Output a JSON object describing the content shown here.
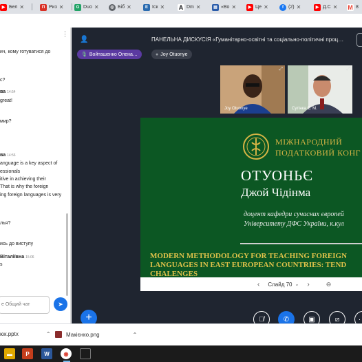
{
  "browser": {
    "tabs": [
      {
        "label": "Бел",
        "favicon": "youtube-icon",
        "color": "#ff0000"
      },
      {
        "label": "Риз",
        "favicon": "pk-icon",
        "color": "#d93025"
      },
      {
        "label": "Duo",
        "favicon": "duo-icon",
        "color": "#21a366"
      },
      {
        "label": "Біб",
        "favicon": "globe-icon",
        "color": "#5f6368"
      },
      {
        "label": "Іск",
        "favicon": "e-icon",
        "color": "#2b6cb0"
      },
      {
        "label": "Dm",
        "favicon": "a-icon",
        "color": "#202124"
      },
      {
        "label": "«Во",
        "favicon": "doc-icon",
        "color": "#2a5caa"
      },
      {
        "label": "Це",
        "favicon": "youtube-icon",
        "color": "#ff0000"
      },
      {
        "label": "(2)",
        "favicon": "facebook-icon",
        "color": "#1877f2"
      },
      {
        "label": "Д.С",
        "favicon": "youtube-icon",
        "color": "#ff0000"
      },
      {
        "label": "8",
        "favicon": "gmail-icon",
        "color": "#ea4335"
      }
    ]
  },
  "chat": {
    "lines": [
      {
        "text": "ич, кому готуватися до",
        "type": "msg"
      },
      {
        "text": "",
        "type": "msg"
      },
      {
        "text": "с?",
        "type": "msg"
      },
      {
        "text": "ва",
        "time": "14:54",
        "type": "name"
      },
      {
        "text": "great!",
        "type": "msg"
      },
      {
        "text": "мир?",
        "type": "msg"
      },
      {
        "text": "ва",
        "time": "14:56",
        "type": "name"
      },
      {
        "text": "anguage is a key aspect of",
        "type": "msg"
      },
      {
        "text": "essionals",
        "type": "msg"
      },
      {
        "text": "itive in achieving their",
        "type": "msg"
      },
      {
        "text": "That is why the foreign",
        "type": "msg"
      },
      {
        "text": "ing foreign languages is very",
        "type": "msg"
      },
      {
        "text": "лья?",
        "type": "msg"
      },
      {
        "text": "ись до виступу",
        "type": "msg"
      },
      {
        "text": "Віталіївна",
        "time": "15:06",
        "type": "name"
      },
      {
        "text": "s",
        "type": "msg"
      }
    ],
    "input_placeholder": "е Общий чат",
    "send_icon": "send-icon"
  },
  "meeting": {
    "title": "ПАНЕЛЬНА ДИСКУСІЯ «Гуманітарно-освітні та соціально-політичні проц…",
    "speaker_chip": "Войташенко Олена…",
    "participant_chip": "Joy Otuonye",
    "thumbnails": [
      {
        "label": "Joy Otuonye"
      },
      {
        "label": "Сутінка С. М."
      }
    ]
  },
  "slide": {
    "org_line1": "МІЖНАРОДНИЙ",
    "org_line2": "ПОДАТКОВИЙ КОНГ",
    "name_line1": "ОТУОНЬЄ",
    "name_line2": "Джой Чідінма",
    "position_line1": "доцент кафедри сучасних європей",
    "position_line2": "Університету ДФС України, к.кул",
    "topic_line1": "MODERN METHODOLOGY FOR TEACHING FOREIGN",
    "topic_line2": "LANGUAGES IN EAST EUROPEAN COUNTRIES: TEND",
    "topic_line3": "CHALENGES",
    "page_label": "Слайд 70"
  },
  "downloads": [
    {
      "name": "юк.pptx",
      "icon": "pptx-icon"
    },
    {
      "name": "Макієнко.png",
      "icon": "image-file-icon"
    }
  ],
  "colors": {
    "accent": "#1a73e8",
    "slide_green": "#0c5723",
    "slide_gold": "#d6b445",
    "meeting_bg": "#1f2530"
  }
}
